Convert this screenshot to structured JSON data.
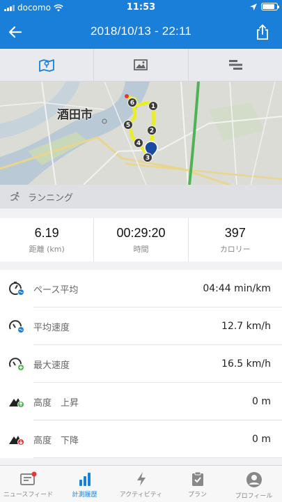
{
  "status_bar": {
    "carrier": "docomo",
    "time": "11:53",
    "battery_level": 0.85
  },
  "header": {
    "title": "2018/10/13 - 22:11",
    "back_icon": "back-arrow-icon",
    "share_icon": "share-icon"
  },
  "tabs": [
    {
      "icon": "map-icon",
      "active": true
    },
    {
      "icon": "photo-icon",
      "active": false
    },
    {
      "icon": "list-bars-icon",
      "active": false
    }
  ],
  "map": {
    "city_label": "酒田市",
    "markers": [
      "1",
      "2",
      "3",
      "4",
      "5",
      "6"
    ]
  },
  "activity": {
    "label": "ランニング"
  },
  "summary": [
    {
      "value": "6.19",
      "label": "距離 (km)"
    },
    {
      "value": "00:29:20",
      "label": "時間"
    },
    {
      "value": "397",
      "label": "カロリー"
    }
  ],
  "metrics": [
    {
      "label": "ペース平均",
      "value": "04:44 min/km",
      "icon": "pace-avg-icon"
    },
    {
      "label": "平均速度",
      "value": "12.7 km/h",
      "icon": "speed-avg-icon"
    },
    {
      "label": "最大速度",
      "value": "16.5 km/h",
      "icon": "speed-max-icon"
    },
    {
      "label": "高度　上昇",
      "value": "0 m",
      "icon": "elevation-up-icon"
    },
    {
      "label": "高度　下降",
      "value": "0 m",
      "icon": "elevation-down-icon"
    }
  ],
  "bottom_nav": [
    {
      "label": "ニュースフィード",
      "icon": "newsfeed-icon",
      "active": false
    },
    {
      "label": "計測履歴",
      "icon": "history-icon",
      "active": true
    },
    {
      "label": "アクティビティ",
      "icon": "activity-icon",
      "active": false
    },
    {
      "label": "プラン",
      "icon": "plan-icon",
      "active": false
    },
    {
      "label": "プロフィール",
      "icon": "profile-icon",
      "active": false
    }
  ],
  "colors": {
    "primary": "#1a7fd8",
    "route": "#e8ef2a",
    "muted": "#888888"
  }
}
